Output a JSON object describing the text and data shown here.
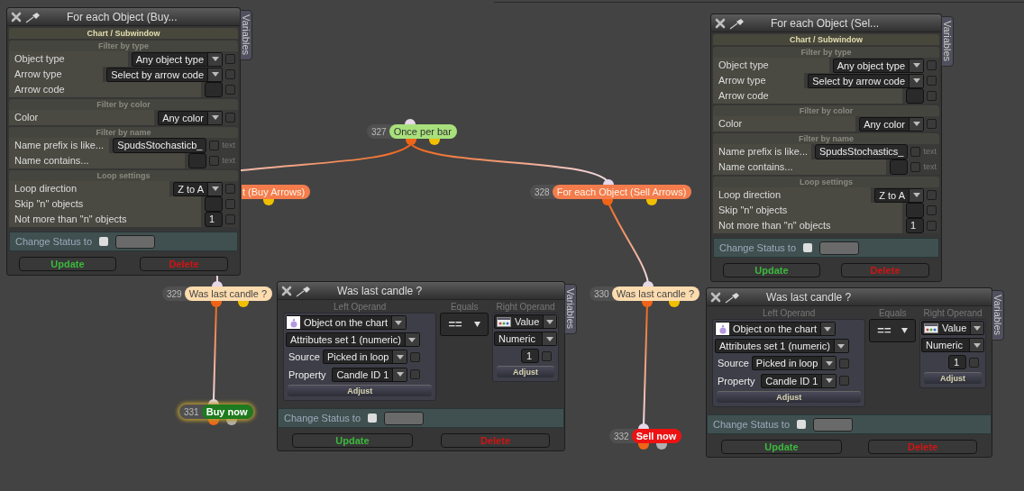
{
  "nodes": [
    {
      "number": "327",
      "label": "Once per bar",
      "color": "#a8e07c",
      "selected": false
    },
    {
      "label": "t (Buy Arrows)",
      "color": "#f47c4c",
      "selected": false
    },
    {
      "number": "328",
      "label": "For each Object (Sell Arrows)",
      "color": "#f47c4c",
      "selected": false
    },
    {
      "number": "329",
      "label": "Was last candle ?",
      "color": "#fcdcae",
      "selected": false
    },
    {
      "number": "330",
      "label": "Was last candle ?",
      "color": "#fcdcae",
      "selected": false
    },
    {
      "number": "331",
      "label": "Buy now",
      "color": "#1e7a1e",
      "selected": true
    },
    {
      "number": "332",
      "label": "Sell now",
      "color": "#ee1212",
      "selected": false
    }
  ],
  "for_each_windows": [
    {
      "title": "For each Object (Buy...",
      "tab": "Variables",
      "section": "Chart / Subwindow",
      "groups": [
        {
          "heading": "Filter by type",
          "rows": [
            {
              "label": "Object type",
              "kind": "dropdown",
              "value": "Any object type",
              "checked": false
            },
            {
              "label": "Arrow type",
              "kind": "dropdown",
              "value": "Select by arrow code",
              "checked": false
            },
            {
              "label": "Arrow code",
              "kind": "input",
              "checked": false
            }
          ]
        },
        {
          "heading": "Filter by color",
          "rows": [
            {
              "label": "Color",
              "kind": "dropdown",
              "value": "Any color",
              "checked": false
            }
          ]
        },
        {
          "heading": "Filter by name",
          "rows": [
            {
              "label": "Name prefix is like...",
              "kind": "input",
              "value": "SpudsStochasticb_",
              "checked": false,
              "suffix": "text"
            },
            {
              "label": "Name contains...",
              "kind": "input",
              "checked": false,
              "suffix": "text"
            }
          ]
        },
        {
          "heading": "Loop settings",
          "rows": [
            {
              "label": "Loop direction",
              "kind": "dropdown",
              "value": "Z to A",
              "checked": false
            },
            {
              "label": "Skip \"n\" objects",
              "kind": "input",
              "checked": false
            },
            {
              "label": "Not more than \"n\" objects",
              "kind": "input",
              "value": "1",
              "checked": false
            }
          ]
        }
      ],
      "change_status": {
        "label": "Change Status to",
        "checked": false
      },
      "buttons": [
        {
          "label": "Update",
          "kind": "update"
        },
        {
          "label": "Delete",
          "kind": "delete"
        }
      ]
    },
    {
      "title": "For each Object (Sel...",
      "tab": "Variables",
      "section": "Chart / Subwindow",
      "groups": [
        {
          "heading": "Filter by type",
          "rows": [
            {
              "label": "Object type",
              "kind": "dropdown",
              "value": "Any object type",
              "checked": false
            },
            {
              "label": "Arrow type",
              "kind": "dropdown",
              "value": "Select by arrow code",
              "checked": false
            },
            {
              "label": "Arrow code",
              "kind": "input",
              "checked": false
            }
          ]
        },
        {
          "heading": "Filter by color",
          "rows": [
            {
              "label": "Color",
              "kind": "dropdown",
              "value": "Any color",
              "checked": false
            }
          ]
        },
        {
          "heading": "Filter by name",
          "rows": [
            {
              "label": "Name prefix is like...",
              "kind": "input",
              "value": "SpudsStochastics_",
              "checked": false,
              "suffix": "text"
            },
            {
              "label": "Name contains...",
              "kind": "input",
              "checked": false,
              "suffix": "text"
            }
          ]
        },
        {
          "heading": "Loop settings",
          "rows": [
            {
              "label": "Loop direction",
              "kind": "dropdown",
              "value": "Z to A",
              "checked": false
            },
            {
              "label": "Skip \"n\" objects",
              "kind": "input",
              "checked": false
            },
            {
              "label": "Not more than \"n\" objects",
              "kind": "input",
              "value": "1",
              "checked": false
            }
          ]
        }
      ],
      "change_status": {
        "label": "Change Status to",
        "checked": false
      },
      "buttons": [
        {
          "label": "Update",
          "kind": "update"
        },
        {
          "label": "Delete",
          "kind": "delete"
        }
      ]
    }
  ],
  "condition_windows": [
    {
      "title": "Was last candle ?",
      "tab": "Variables",
      "left_operand": {
        "heading": "Left Operand",
        "source": "Object on the chart",
        "attribute": "Attributes set 1 (numeric)",
        "rows": [
          {
            "label": "Source",
            "value": "Picked in loop",
            "checked": false
          },
          {
            "label": "Property",
            "value": "Candle ID 1",
            "checked": false
          }
        ],
        "adjust": "Adjust"
      },
      "equals": {
        "heading": "Equals",
        "value": "=="
      },
      "right_operand": {
        "heading": "Right Operand",
        "type": "Value",
        "format": "Numeric",
        "value": "1",
        "checked": false,
        "adjust": "Adjust"
      },
      "change_status": {
        "label": "Change Status to",
        "checked": false
      },
      "buttons": [
        {
          "label": "Update",
          "kind": "update"
        },
        {
          "label": "Delete",
          "kind": "delete"
        }
      ]
    },
    {
      "title": "Was last candle ?",
      "tab": "Variables",
      "left_operand": {
        "heading": "Left Operand",
        "source": "Object on the chart",
        "attribute": "Attributes set 1 (numeric)",
        "rows": [
          {
            "label": "Source",
            "value": "Picked in loop",
            "checked": false
          },
          {
            "label": "Property",
            "value": "Candle ID 1",
            "checked": false
          }
        ],
        "adjust": "Adjust"
      },
      "equals": {
        "heading": "Equals",
        "value": "=="
      },
      "right_operand": {
        "heading": "Right Operand",
        "type": "Value",
        "format": "Numeric",
        "value": "1",
        "checked": false,
        "adjust": "Adjust"
      },
      "change_status": {
        "label": "Change Status to",
        "checked": false
      },
      "buttons": [
        {
          "label": "Update",
          "kind": "update"
        },
        {
          "label": "Delete",
          "kind": "delete"
        }
      ]
    }
  ]
}
